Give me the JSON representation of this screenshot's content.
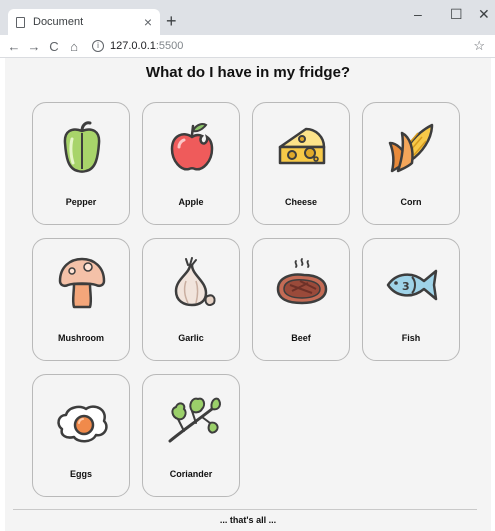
{
  "browser": {
    "tab_title": "Document",
    "tab_close": "×",
    "new_tab": "+",
    "minimize": "–",
    "maximize": "☐",
    "close": "✕",
    "back": "←",
    "forward": "→",
    "reload": "C",
    "home": "⌂",
    "info": "i",
    "url_host": "127.0.0.1",
    "url_port": ":5500",
    "bookmark": "☆"
  },
  "page": {
    "title": "What do I have in my fridge?",
    "footer": "... that's all ..."
  },
  "items": [
    {
      "label": "Pepper",
      "icon": "pepper-icon"
    },
    {
      "label": "Apple",
      "icon": "apple-icon"
    },
    {
      "label": "Cheese",
      "icon": "cheese-icon"
    },
    {
      "label": "Corn",
      "icon": "corn-icon"
    },
    {
      "label": "Mushroom",
      "icon": "mushroom-icon"
    },
    {
      "label": "Garlic",
      "icon": "garlic-icon"
    },
    {
      "label": "Beef",
      "icon": "beef-icon"
    },
    {
      "label": "Fish",
      "icon": "fish-icon"
    },
    {
      "label": "Eggs",
      "icon": "eggs-icon"
    },
    {
      "label": "Coriander",
      "icon": "coriander-icon"
    }
  ],
  "colors": {
    "page_background": "#f4f4f4",
    "card_border": "#b9b9b9",
    "outline": "#3d3d3d"
  }
}
